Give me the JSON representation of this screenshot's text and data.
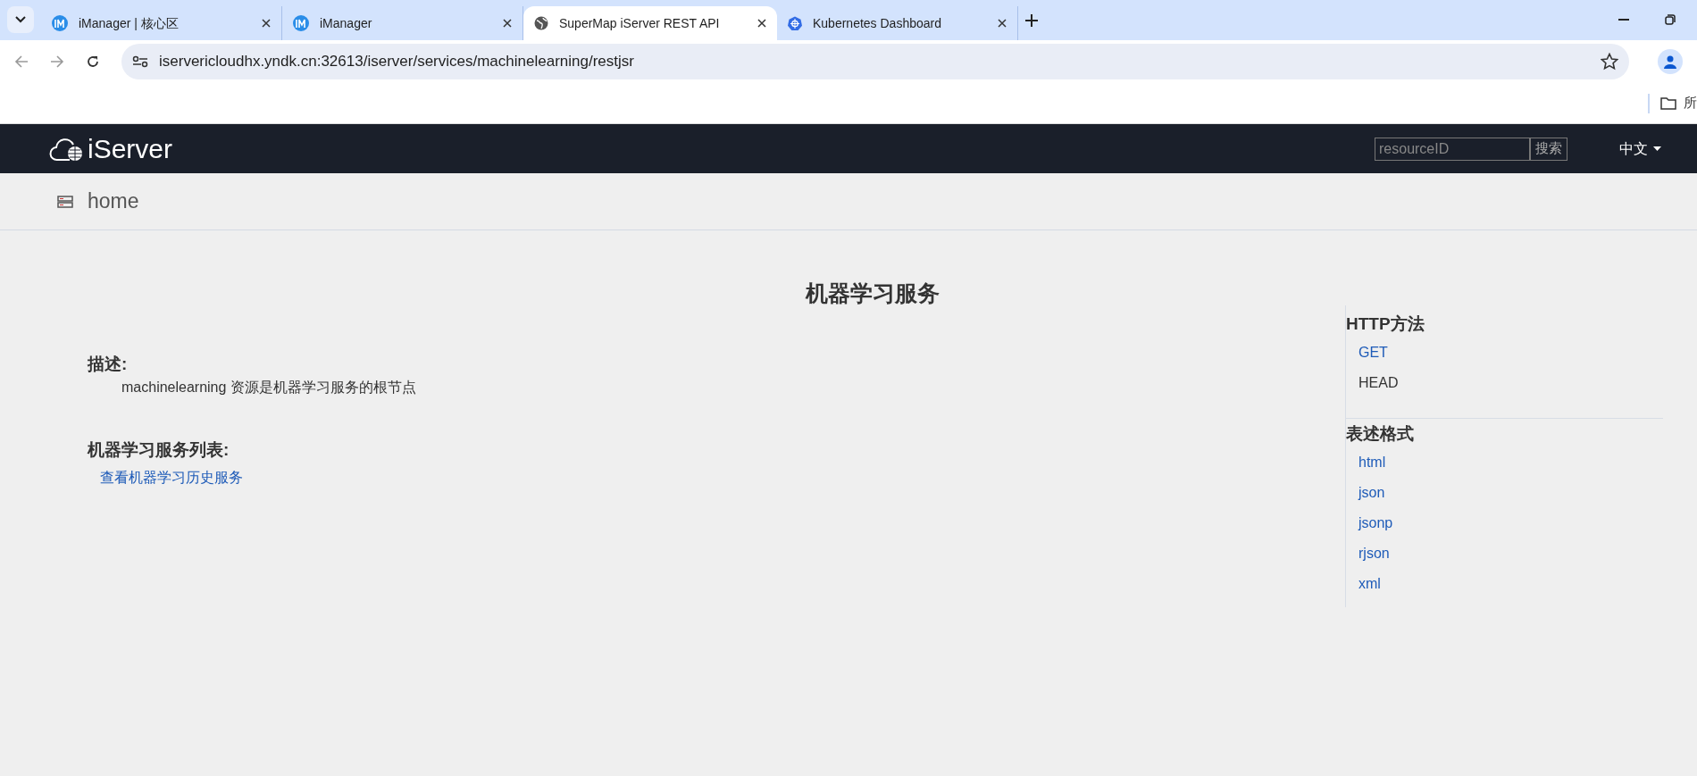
{
  "browser": {
    "tabs": [
      {
        "title": "iManager | 核心区",
        "kind": "imanager",
        "selected": false
      },
      {
        "title": "iManager",
        "kind": "imanager",
        "selected": false
      },
      {
        "title": "SuperMap iServer REST API",
        "kind": "web",
        "selected": true
      },
      {
        "title": "Kubernetes Dashboard",
        "kind": "kubernetes",
        "selected": false
      }
    ],
    "address": "iservericloudhx.yndk.cn:32613/iserver/services/machinelearning/restjsr",
    "bookmarks": [
      {
        "label": "所"
      }
    ]
  },
  "navbar": {
    "logo": "iServer",
    "search": {
      "placeholder": "resourceID",
      "button": "搜索"
    },
    "language": "中文"
  },
  "breadcrumb": "home",
  "page": {
    "title": "机器学习服务",
    "description_heading": "描述:",
    "description": "machinelearning 资源是机器学习服务的根节点",
    "list_heading": "机器学习服务列表:",
    "list_links": [
      "查看机器学习历史服务"
    ]
  },
  "sidebar": {
    "sections": [
      {
        "heading": "HTTP方法",
        "items": [
          {
            "label": "GET",
            "kind": "link"
          },
          {
            "label": "HEAD",
            "kind": "text"
          }
        ]
      },
      {
        "heading": "表述格式",
        "items": [
          {
            "label": "html",
            "kind": "link"
          },
          {
            "label": "json",
            "kind": "link"
          },
          {
            "label": "jsonp",
            "kind": "link"
          },
          {
            "label": "rjson",
            "kind": "link"
          },
          {
            "label": "xml",
            "kind": "link"
          }
        ]
      }
    ]
  }
}
